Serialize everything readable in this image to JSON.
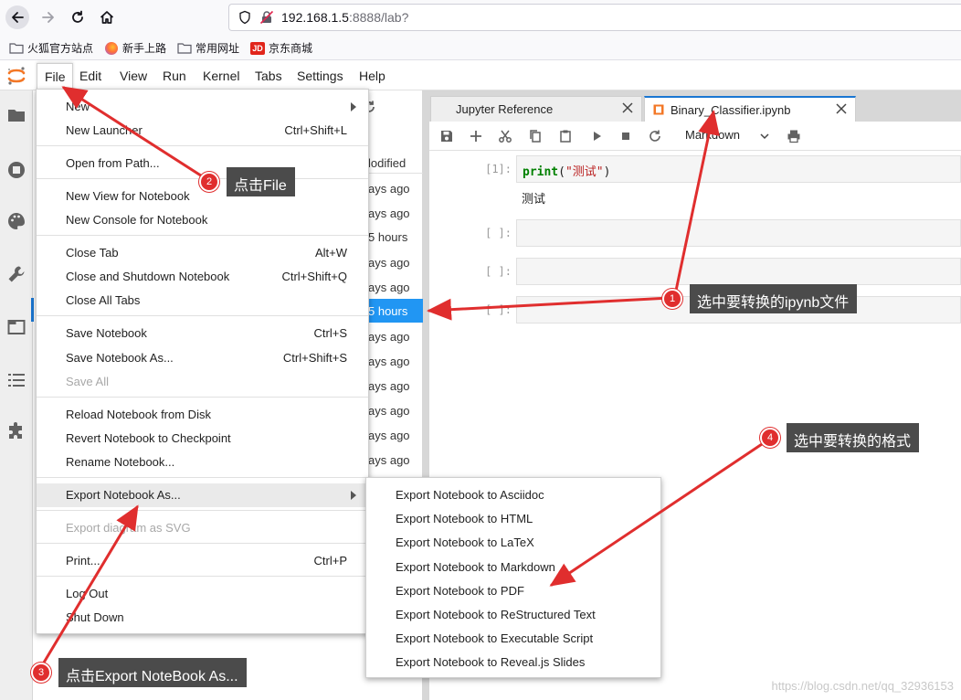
{
  "browser": {
    "url_host": "192.168.1.5",
    "url_rest": ":8888/lab?",
    "bookmarks": [
      "火狐官方站点",
      "新手上路",
      "常用网址",
      "京东商城"
    ],
    "jd_icon_text": "JD"
  },
  "menubar": [
    "File",
    "Edit",
    "View",
    "Run",
    "Kernel",
    "Tabs",
    "Settings",
    "Help"
  ],
  "file_browser": {
    "header": "lodified",
    "times": [
      "ays ago",
      "ays ago",
      "5 hours",
      "ays ago",
      "ays ago",
      "5 hours",
      "ays ago",
      "ays ago",
      "ays ago",
      "ays ago",
      "ays ago",
      "ays ago"
    ],
    "selected_index": 5
  },
  "tabs": [
    {
      "label": "Jupyter Reference"
    },
    {
      "label": "Binary_Classifier.ipynb"
    }
  ],
  "notebook": {
    "cell_type": "Markdown",
    "cells": [
      {
        "prompt": "[1]:",
        "code_fn": "print",
        "code_open": "(",
        "code_str": "\"测试\"",
        "code_close": ")",
        "output": "测试"
      },
      {
        "prompt": "[ ]:"
      },
      {
        "prompt": "[ ]:"
      },
      {
        "prompt": "[ ]:"
      }
    ]
  },
  "file_menu": {
    "items": [
      {
        "label": "New",
        "shortcut": "",
        "submenu": true
      },
      {
        "label": "New Launcher",
        "shortcut": "Ctrl+Shift+L"
      },
      {
        "label": "Open from Path...",
        "shortcut": ""
      },
      {
        "label": "New View for Notebook",
        "shortcut": ""
      },
      {
        "label": "New Console for Notebook",
        "shortcut": ""
      },
      {
        "label": "Close Tab",
        "shortcut": "Alt+W"
      },
      {
        "label": "Close and Shutdown Notebook",
        "shortcut": "Ctrl+Shift+Q"
      },
      {
        "label": "Close All Tabs",
        "shortcut": ""
      },
      {
        "label": "Save Notebook",
        "shortcut": "Ctrl+S"
      },
      {
        "label": "Save Notebook As...",
        "shortcut": "Ctrl+Shift+S"
      },
      {
        "label": "Save All",
        "shortcut": "",
        "disabled": true
      },
      {
        "label": "Reload Notebook from Disk",
        "shortcut": ""
      },
      {
        "label": "Revert Notebook to Checkpoint",
        "shortcut": ""
      },
      {
        "label": "Rename Notebook...",
        "shortcut": ""
      },
      {
        "label": "Export Notebook As...",
        "shortcut": "",
        "submenu": true,
        "hovered": true
      },
      {
        "label": "Export diagram as SVG",
        "shortcut": "",
        "disabled": true
      },
      {
        "label": "Print...",
        "shortcut": "Ctrl+P"
      },
      {
        "label": "Log Out",
        "shortcut": ""
      },
      {
        "label": "Shut Down",
        "shortcut": ""
      }
    ]
  },
  "export_menu": {
    "items": [
      "Export Notebook to Asciidoc",
      "Export Notebook to HTML",
      "Export Notebook to LaTeX",
      "Export Notebook to Markdown",
      "Export Notebook to PDF",
      "Export Notebook to ReStructured Text",
      "Export Notebook to Executable Script",
      "Export Notebook to Reveal.js Slides"
    ]
  },
  "annotations": [
    {
      "number": "1",
      "text": "选中要转换的ipynb文件"
    },
    {
      "number": "2",
      "text": "点击File"
    },
    {
      "number": "3",
      "text": "点击Export NoteBook As..."
    },
    {
      "number": "4",
      "text": "选中要转换的格式"
    }
  ],
  "watermark": "https://blog.csdn.net/qq_32936153",
  "colors": {
    "annotation_red": "#e02e2e",
    "callout_bg": "#4b4b4b",
    "selection_blue": "#2196f3"
  }
}
